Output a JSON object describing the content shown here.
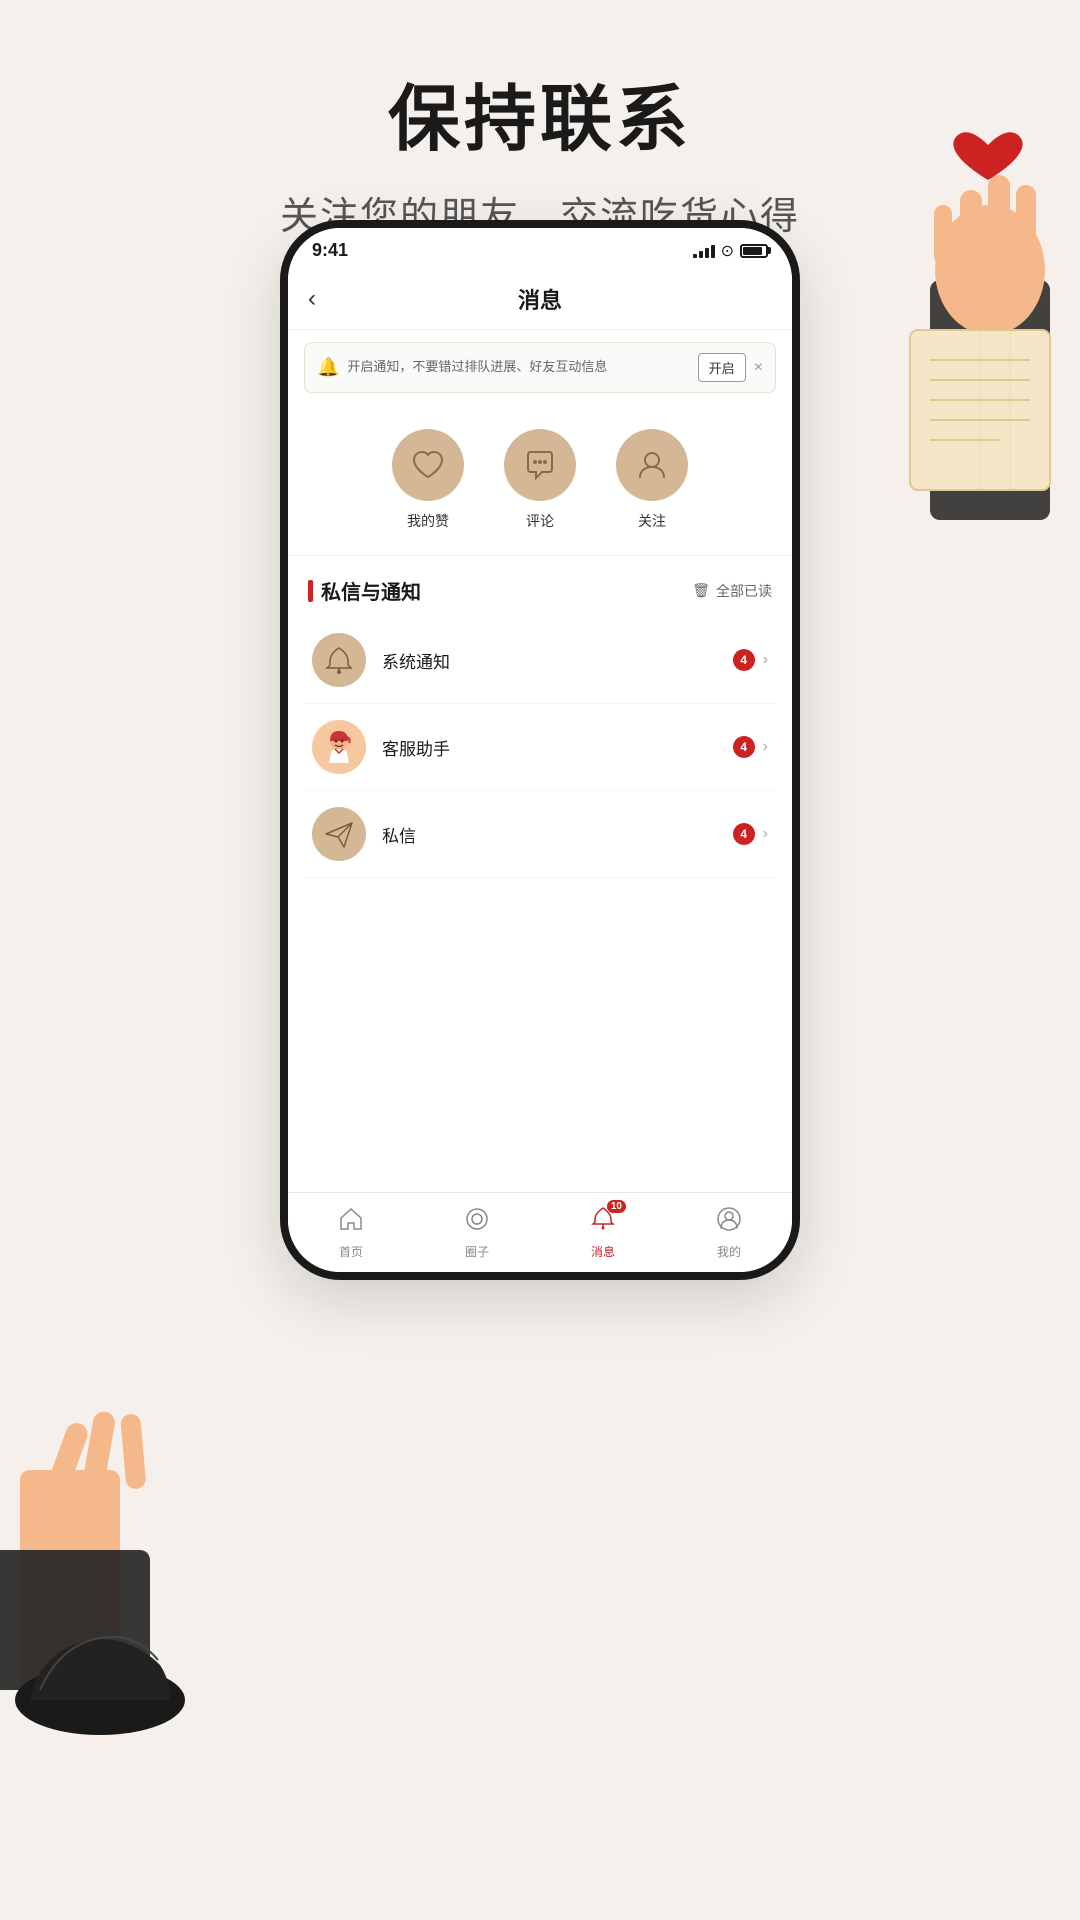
{
  "page": {
    "title": "保持联系",
    "subtitle": "关注您的朋友，交流吃货心得"
  },
  "statusBar": {
    "time": "9:41"
  },
  "navbar": {
    "backLabel": "‹",
    "title": "消息"
  },
  "notificationBanner": {
    "text": "开启通知，不要错过排队进展、好友互动信息",
    "enableLabel": "开启",
    "closeLabel": "×"
  },
  "iconGrid": {
    "items": [
      {
        "label": "我的赞",
        "icon": "♡"
      },
      {
        "label": "评论",
        "icon": "💬"
      },
      {
        "label": "关注",
        "icon": "👤"
      }
    ]
  },
  "sectionHeader": {
    "title": "私信与通知",
    "actionIcon": "🗑",
    "actionLabel": "全部已读"
  },
  "messageList": {
    "items": [
      {
        "name": "系统通知",
        "icon": "🔔",
        "badge": "4",
        "iconBg": "#d4b896"
      },
      {
        "name": "客服助手",
        "icon": "👧",
        "badge": "4",
        "iconBg": "#f0d0c0"
      },
      {
        "name": "私信",
        "icon": "✈",
        "badge": "4",
        "iconBg": "#d4b896"
      }
    ]
  },
  "tabBar": {
    "items": [
      {
        "label": "首页",
        "icon": "⌂",
        "active": false
      },
      {
        "label": "圈子",
        "icon": "◎",
        "active": false
      },
      {
        "label": "消息",
        "icon": "🔔",
        "active": true,
        "badge": "10"
      },
      {
        "label": "我的",
        "icon": "☺",
        "active": false
      }
    ]
  }
}
